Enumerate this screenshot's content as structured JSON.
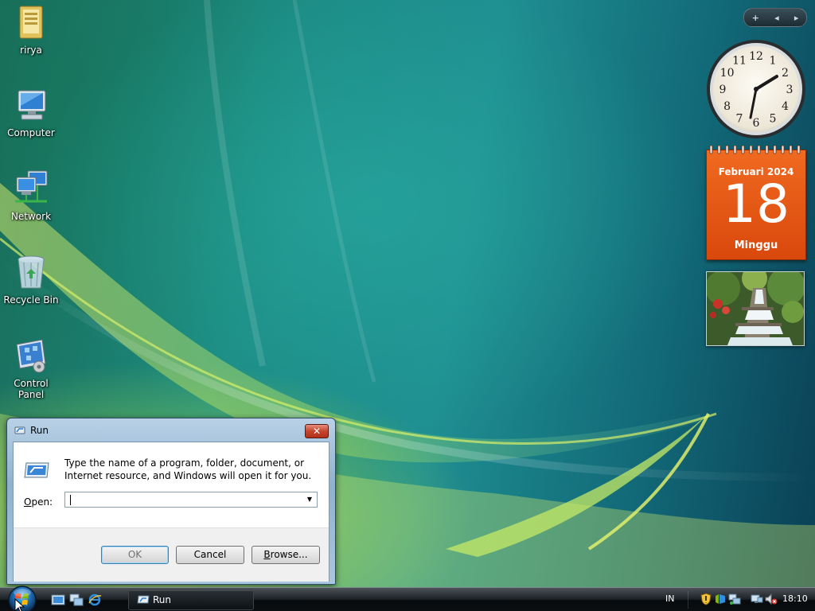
{
  "desktop": {
    "icons": [
      {
        "label": "rirya",
        "icon": "user-folder-icon"
      },
      {
        "label": "Computer",
        "icon": "computer-icon"
      },
      {
        "label": "Network",
        "icon": "network-icon"
      },
      {
        "label": "Recycle Bin",
        "icon": "recycle-bin-icon"
      },
      {
        "label": "Control Panel",
        "icon": "control-panel-icon"
      }
    ]
  },
  "sidebar": {
    "add_label": "+",
    "prev_label": "◂",
    "next_label": "▸"
  },
  "clock_gadget": {
    "numerals": [
      "12",
      "1",
      "2",
      "3",
      "4",
      "5",
      "6",
      "7",
      "8",
      "9",
      "10",
      "11"
    ]
  },
  "calendar_gadget": {
    "month_year": "Februari 2024",
    "day": "18",
    "weekday": "Minggu"
  },
  "slideshow_gadget": {
    "icon": "waterfall-photo"
  },
  "run_dialog": {
    "title": "Run",
    "close_label": "✕",
    "description": "Type the name of a program, folder, document, or Internet resource, and Windows will open it for you.",
    "open_label_prefix": "",
    "open_label_underlined": "O",
    "open_label_rest": "pen:",
    "open_value": "",
    "ok_label": "OK",
    "cancel_label": "Cancel",
    "browse_label_underlined": "B",
    "browse_label_rest": "rowse..."
  },
  "taskbar": {
    "start_icon": "windows-orb-icon",
    "quick_launch": [
      "show-desktop-icon",
      "switch-windows-icon",
      "internet-explorer-icon"
    ],
    "task_items": [
      {
        "label": "Run",
        "icon": "run-icon"
      }
    ],
    "language": "IN",
    "tray_icons": [
      "security-shield-icon",
      "windows-update-icon",
      "network-tray-icon",
      "volume-muted-icon"
    ],
    "time": "18:10"
  },
  "colors": {
    "calendar_orange": "#e85a16",
    "taskbar_dark": "#0b0f12",
    "dialog_frame": "#a9c6df"
  }
}
